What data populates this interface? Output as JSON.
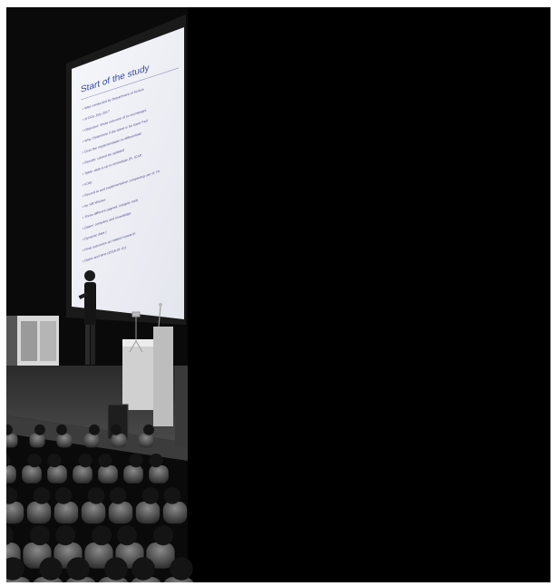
{
  "photo": {
    "subject": "Speaker presenting on a stage in front of a large projection screen with an audience in the foreground",
    "slide": {
      "title": "Start of the study",
      "bullets": [
        "Was conducted by Department of Justice",
        "of DOL July 2017",
        "Objective: Show outcome of ex-exchanges",
        "Why: Determine if the ticket is for lower Fed",
        "Over the implementation to differentiate",
        "Results: cannot be updated",
        "Table: data is up to immediate (R, ICAP,",
        "ICW)",
        "Record to and implementation completing use of, Dr",
        "for HR Wishes",
        "Three different (signed, integrity met)",
        "Dates: company and knowledge",
        "Dynamic data (",
        "Final outcomes as related research",
        "Dates and time (2018-01-01)"
      ]
    },
    "colors": {
      "background": "#000000",
      "screen": "#f2f3f7",
      "slide_text": "#4c4f86"
    }
  }
}
